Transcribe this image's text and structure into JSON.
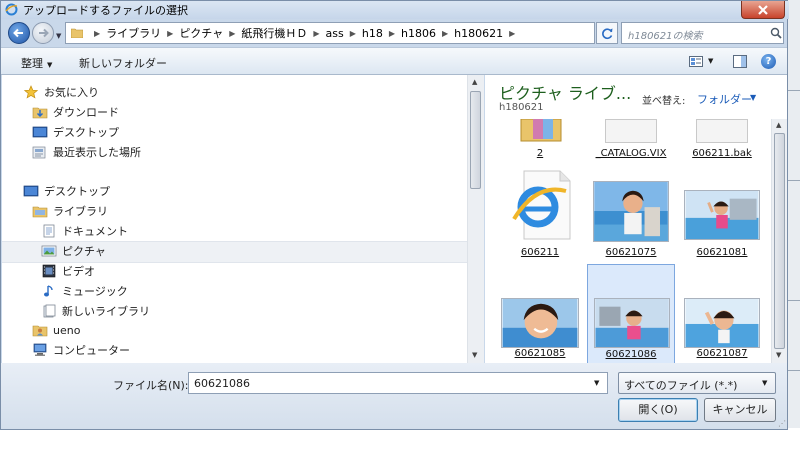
{
  "window": {
    "title": "アップロードするファイルの選択"
  },
  "address": {
    "crumbs": [
      "ライブラリ",
      "ピクチャ",
      "紙飛行機ＨＤ",
      "ass",
      "h18",
      "h1806",
      "h180621"
    ]
  },
  "search": {
    "placeholder": "h180621の検索"
  },
  "toolbar": {
    "organize": "整理",
    "new_folder": "新しいフォルダー"
  },
  "sidebar": {
    "items": [
      {
        "label": "お気に入り",
        "icon": "star-icon"
      },
      {
        "label": "ダウンロード",
        "icon": "download-folder-icon"
      },
      {
        "label": "デスクトップ",
        "icon": "desktop-icon"
      },
      {
        "label": "最近表示した場所",
        "icon": "recent-places-icon"
      },
      {
        "label": "デスクトップ",
        "icon": "desktop-icon"
      },
      {
        "label": "ライブラリ",
        "icon": "library-icon"
      },
      {
        "label": "ドキュメント",
        "icon": "documents-icon"
      },
      {
        "label": "ピクチャ",
        "icon": "pictures-icon"
      },
      {
        "label": "ビデオ",
        "icon": "video-icon"
      },
      {
        "label": "ミュージック",
        "icon": "music-icon"
      },
      {
        "label": "新しいライブラリ",
        "icon": "new-library-icon"
      },
      {
        "label": "ueno",
        "icon": "user-folder-icon"
      },
      {
        "label": "コンピューター",
        "icon": "computer-icon"
      }
    ]
  },
  "content": {
    "library_title": "ピクチャ ライブ...",
    "location": "h180621",
    "arrange_label": "並べ替え:",
    "arrange_value": "フォルダー",
    "files": [
      {
        "name": "2",
        "kind": "folder"
      },
      {
        "name": "_CATALOG.VIX",
        "kind": "file"
      },
      {
        "name": "606211.bak",
        "kind": "file"
      },
      {
        "name": "606211",
        "kind": "ie-document"
      },
      {
        "name": "60621075",
        "kind": "photo"
      },
      {
        "name": "60621081",
        "kind": "photo"
      },
      {
        "name": "60621085",
        "kind": "photo"
      },
      {
        "name": "60621086",
        "kind": "photo",
        "selected": true
      },
      {
        "name": "60621087",
        "kind": "photo"
      }
    ]
  },
  "footer": {
    "filename_label": "ファイル名(N):",
    "filename_value": "60621086",
    "filetype_value": "すべてのファイル (*.*)",
    "open_label": "開く(O)",
    "cancel_label": "キャンセル"
  },
  "colors": {
    "accent": "#1a5bb8",
    "library_title": "#1d5f1d",
    "selection": "#dbe9fb"
  }
}
